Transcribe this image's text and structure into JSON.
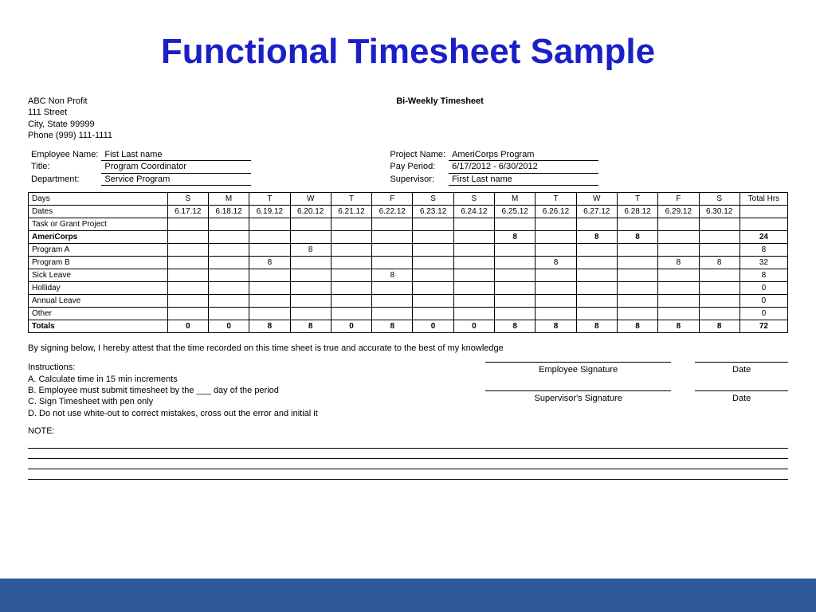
{
  "title": "Functional Timesheet Sample",
  "doc_heading": "Bi-Weekly Timesheet",
  "org": {
    "name": "ABC Non Profit",
    "street": "111 Street",
    "citystate": "City, State 99999",
    "phone": "Phone (999) 111-1111"
  },
  "employee": {
    "name_label": "Employee Name:",
    "name_value": "Fist Last name",
    "title_label": "Title:",
    "title_value": "Program Coordinator",
    "dept_label": "Department:",
    "dept_value": "Service Program"
  },
  "project": {
    "name_label": "Project Name:",
    "name_value": "AmeriCorps Program",
    "period_label": "Pay Period:",
    "period_value": "6/17/2012 - 6/30/2012",
    "supervisor_label": "Supervisor:",
    "supervisor_value": "First Last name"
  },
  "grid": {
    "days_label": "Days",
    "days": [
      "S",
      "M",
      "T",
      "W",
      "T",
      "F",
      "S",
      "S",
      "M",
      "T",
      "W",
      "T",
      "F",
      "S"
    ],
    "dates_label": "Dates",
    "dates": [
      "6.17.12",
      "6.18.12",
      "6.19.12",
      "6.20.12",
      "6.21.12",
      "6.22.12",
      "6.23.12",
      "6.24.12",
      "6.25.12",
      "6.26.12",
      "6.27.12",
      "6.28.12",
      "6.29.12",
      "6.30.12"
    ],
    "total_header": "Total Hrs",
    "task_header": "Task or Grant Project",
    "rows": [
      {
        "label": "AmeriCorps",
        "bold": true,
        "cells": [
          "",
          "",
          "",
          "",
          "",
          "",
          "",
          "",
          "8",
          "",
          "8",
          "8",
          "",
          ""
        ],
        "total": "24"
      },
      {
        "label": "Program A",
        "cells": [
          "",
          "",
          "",
          "8",
          "",
          "",
          "",
          "",
          "",
          "",
          "",
          "",
          "",
          ""
        ],
        "total": "8"
      },
      {
        "label": "Program B",
        "cells": [
          "",
          "",
          "8",
          "",
          "",
          "",
          "",
          "",
          "",
          "8",
          "",
          "",
          "8",
          "8"
        ],
        "total": "32"
      },
      {
        "label": "Sick Leave",
        "cells": [
          "",
          "",
          "",
          "",
          "",
          "8",
          "",
          "",
          "",
          "",
          "",
          "",
          "",
          ""
        ],
        "total": "8"
      },
      {
        "label": "Holliday",
        "cells": [
          "",
          "",
          "",
          "",
          "",
          "",
          "",
          "",
          "",
          "",
          "",
          "",
          "",
          ""
        ],
        "total": "0"
      },
      {
        "label": "Annual Leave",
        "cells": [
          "",
          "",
          "",
          "",
          "",
          "",
          "",
          "",
          "",
          "",
          "",
          "",
          "",
          ""
        ],
        "total": "0"
      },
      {
        "label": "Other",
        "cells": [
          "",
          "",
          "",
          "",
          "",
          "",
          "",
          "",
          "",
          "",
          "",
          "",
          "",
          ""
        ],
        "total": "0"
      }
    ],
    "totals_label": "Totals",
    "totals_cells": [
      "0",
      "0",
      "8",
      "8",
      "0",
      "8",
      "0",
      "0",
      "8",
      "8",
      "8",
      "8",
      "8",
      "8"
    ],
    "totals_total": "72"
  },
  "attestation": "By signing below, I hereby attest that the time recorded on this time sheet is true and accurate to the best of my knowledge",
  "instructions": {
    "header": "Instructions:",
    "a": "A. Calculate time in 15 min increments",
    "b": "B. Employee must submit timesheet by the ___ day of the period",
    "c": "C. Sign Timesheet with pen only",
    "d": "D. Do not use white-out to correct mistakes, cross out the error and initial it"
  },
  "signatures": {
    "emp": "Employee Signature",
    "sup": "Supervisor's Signature",
    "date": "Date"
  },
  "note_label": "NOTE:"
}
